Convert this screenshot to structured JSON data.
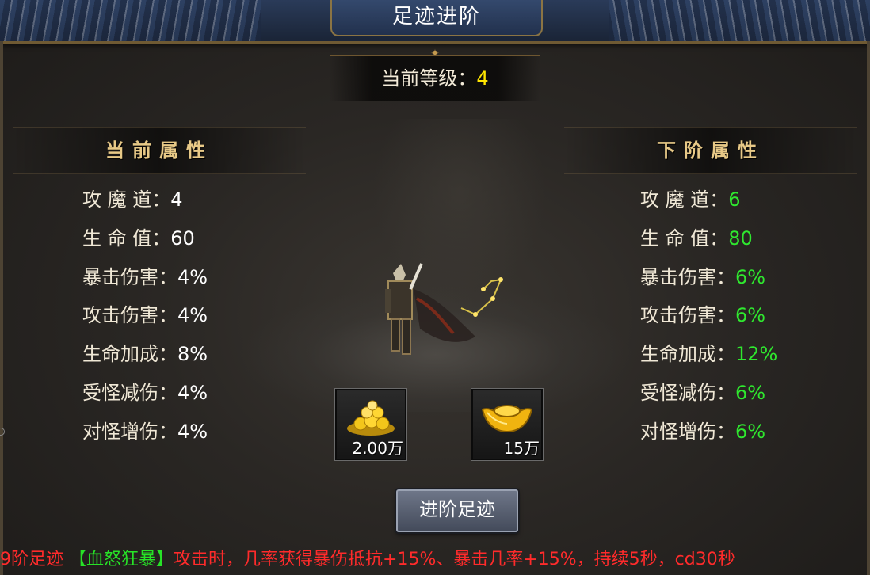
{
  "header": {
    "title": "足迹进阶"
  },
  "level": {
    "label": "当前等级：",
    "value": "4"
  },
  "current": {
    "heading": "当前属性",
    "attrs": [
      {
        "name": "攻 魔 道：",
        "value": "4"
      },
      {
        "name": "生 命 值：",
        "value": "60"
      },
      {
        "name": "暴击伤害：",
        "value": "4%"
      },
      {
        "name": "攻击伤害：",
        "value": "4%"
      },
      {
        "name": "生命加成：",
        "value": "8%"
      },
      {
        "name": "受怪减伤：",
        "value": "4%"
      },
      {
        "name": "对怪增伤：",
        "value": "4%"
      }
    ]
  },
  "next": {
    "heading": "下阶属性",
    "attrs": [
      {
        "name": "攻 魔 道：",
        "value": "6"
      },
      {
        "name": "生 命 值：",
        "value": "80"
      },
      {
        "name": "暴击伤害：",
        "value": "6%"
      },
      {
        "name": "攻击伤害：",
        "value": "6%"
      },
      {
        "name": "生命加成：",
        "value": "12%"
      },
      {
        "name": "受怪减伤：",
        "value": "6%"
      },
      {
        "name": "对怪增伤：",
        "value": "6%"
      }
    ]
  },
  "costs": [
    {
      "icon": "gold-coins-icon",
      "amount": "2.00万"
    },
    {
      "icon": "gold-ingot-icon",
      "amount": "15万"
    }
  ],
  "button": {
    "label": "进阶足迹"
  },
  "footer": {
    "part1": "9阶足迹",
    "part2": "【血怒狂暴】",
    "part3": "攻击时，几率获得暴伤抵抗+15%、暴击几率+15%，持续5秒，cd30秒"
  },
  "colors": {
    "next_value": "#2fe82f",
    "level_value": "#ffe600",
    "footer_red": "#ff2b2b",
    "footer_green": "#27e327",
    "heading_gold": "#e8c987"
  }
}
